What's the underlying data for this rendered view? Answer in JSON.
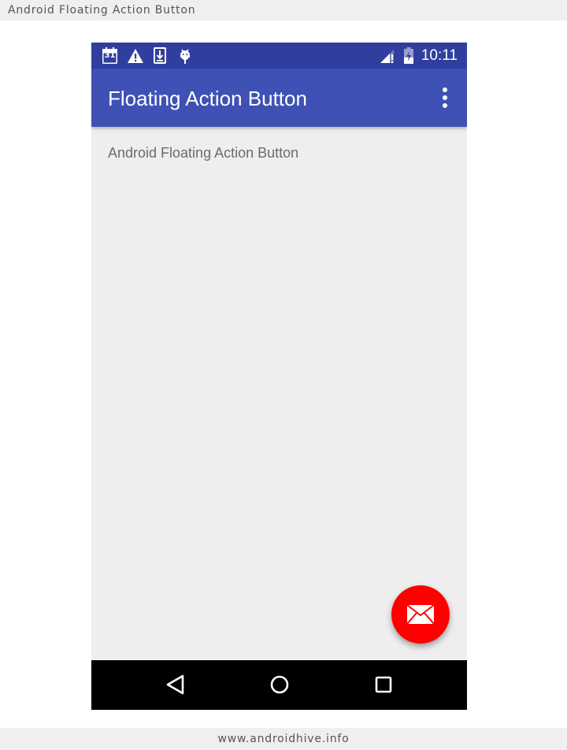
{
  "page": {
    "header_text": "Android Floating Action Button",
    "footer_text": "www.androidhive.info"
  },
  "status_bar": {
    "time": "10:11",
    "calendar_day": "31",
    "left_icons": [
      "calendar-icon",
      "warning-icon",
      "download-icon",
      "android-debug-icon"
    ],
    "right_icons": [
      "signal-icon",
      "battery-charging-icon"
    ]
  },
  "toolbar": {
    "title": "Floating Action Button",
    "menu_icon": "more-vert-icon"
  },
  "content": {
    "text": "Android Floating Action Button"
  },
  "fab": {
    "icon": "email-icon",
    "color": "#ff0000"
  },
  "nav_bar": {
    "buttons": [
      "back-icon",
      "home-icon",
      "recents-icon"
    ]
  },
  "colors": {
    "primary": "#3f51b5",
    "primary_dark": "#303f9f",
    "accent": "#ff0000",
    "background": "#eeeeee"
  }
}
